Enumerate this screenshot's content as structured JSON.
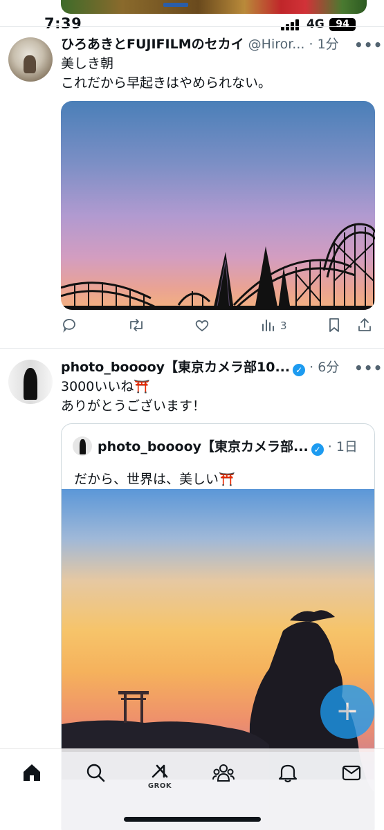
{
  "status_bar": {
    "time": "7:39",
    "network": "4G",
    "battery": "94"
  },
  "tweets": [
    {
      "name": "ひろあきとFUJIFILMのセカイ",
      "handle": "@Hiror...",
      "sep": "·",
      "time": "1分",
      "more": "•••",
      "lines": [
        "美しき朝",
        "これだから早起きはやめられない。"
      ],
      "actions": {
        "views": "3"
      }
    },
    {
      "name": "photo_booooy【東京カメラ部10...",
      "sep": "·",
      "time": "6分",
      "more": "•••",
      "lines": [
        "3000いいね⛩️",
        "ありがとうございます！"
      ],
      "quote": {
        "name": "photo_booooy【東京カメラ部...",
        "sep": "·",
        "time": "1日",
        "text": "だから、世界は、美しい⛩️"
      }
    }
  ],
  "fab": {
    "label": "+"
  },
  "tabbar": {
    "grok_label": "GROK"
  },
  "colors": {
    "accent": "#1d9bf0",
    "text": "#0f1419",
    "muted": "#536471"
  }
}
